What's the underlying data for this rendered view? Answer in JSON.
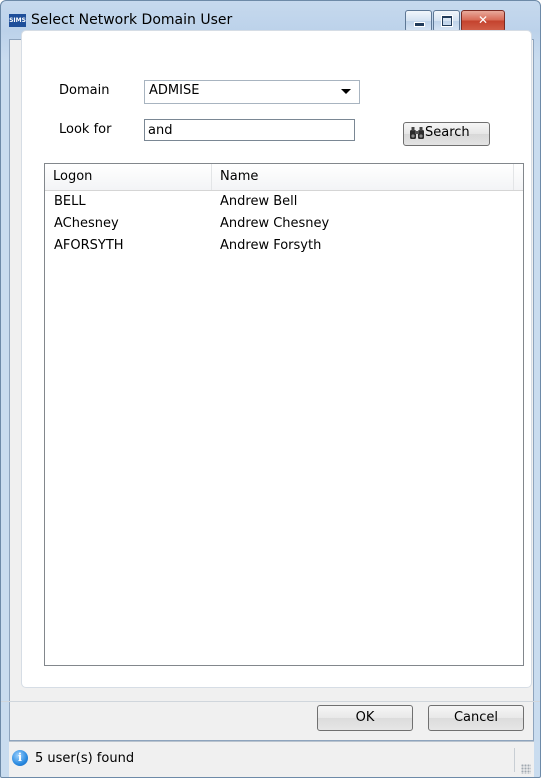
{
  "window": {
    "title": "Select Network Domain User",
    "app_icon_text": "SIMS"
  },
  "form": {
    "domain_label": "Domain",
    "domain_value": "ADMISE",
    "look_for_label": "Look for",
    "look_for_value": "and",
    "search_label": "Search"
  },
  "list": {
    "columns": [
      "Logon",
      "Name"
    ],
    "rows": [
      {
        "logon": "BELL",
        "name": "Andrew Bell"
      },
      {
        "logon": "AChesney",
        "name": "Andrew Chesney"
      },
      {
        "logon": "AFORSYTH",
        "name": "Andrew Forsyth"
      }
    ]
  },
  "buttons": {
    "ok_label": "OK",
    "cancel_label": "Cancel"
  },
  "status": {
    "icon": "info-icon",
    "text": "5 user(s) found"
  }
}
